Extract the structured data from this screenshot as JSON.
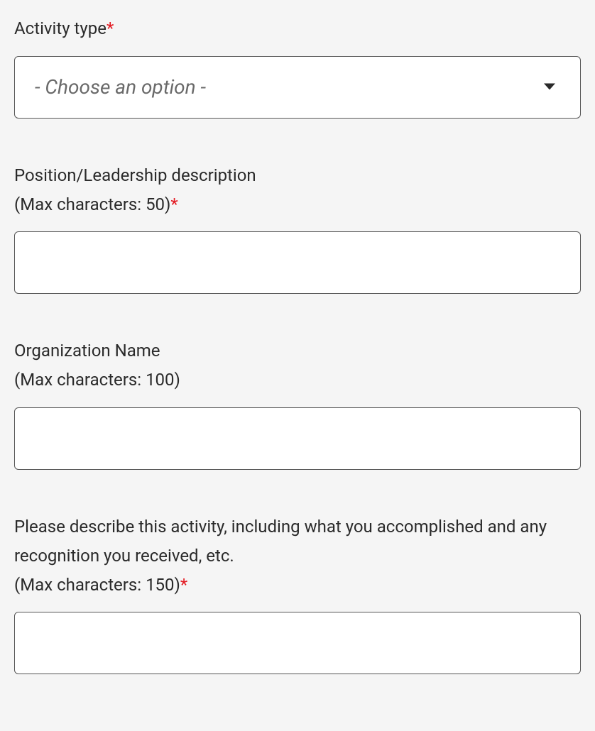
{
  "fields": {
    "activityType": {
      "label": "Activity type",
      "required": true,
      "placeholder": "- Choose an option -"
    },
    "position": {
      "label": "Position/Leadership description",
      "maxHint": "(Max characters: 50)",
      "required": true
    },
    "organization": {
      "label": "Organization Name",
      "maxHint": "(Max characters: 100)",
      "required": false
    },
    "description": {
      "label": "Please describe this activity, including what you accomplished and any recognition you received, etc.",
      "maxHint": "(Max characters: 150)",
      "required": true
    }
  },
  "requiredMark": "*"
}
